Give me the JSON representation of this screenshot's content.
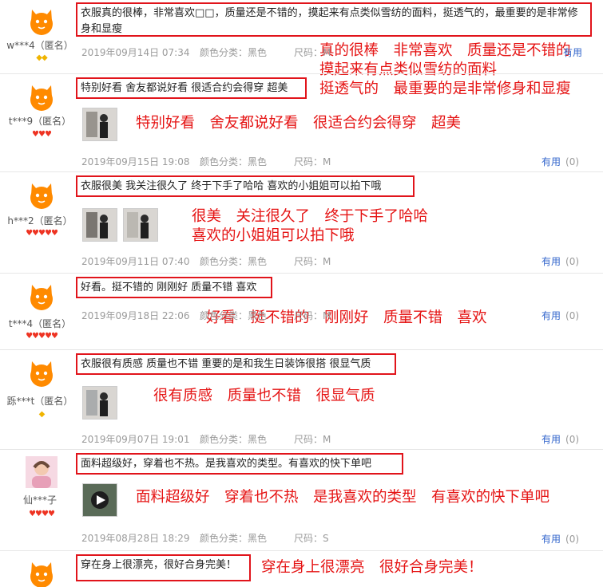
{
  "reviews": [
    {
      "user": "w***4（匿名）",
      "badges": [
        "gold",
        "gold"
      ],
      "comment": "衣服真的很棒，非常喜欢□□，质量还是不错的，摸起来有点类似雪纺的面料，挺透气的，最重要的是非常修身和显瘦",
      "annotation_lines": [
        "真的很棒　非常喜欢　质量还是不错的",
        "摸起来有点类似雪纺的面料",
        "挺透气的　最重要的是非常修身和显瘦"
      ],
      "date": "2019年09月14日 07:34",
      "color": "颜色分类：黑色",
      "size": "尺码：M",
      "useful_label": "有用",
      "useful_count": "(0)",
      "thumbs": []
    },
    {
      "user": "t***9（匿名）",
      "badges": [
        "red",
        "red",
        "red"
      ],
      "comment": "特别好看 舍友都说好看 很适合约会得穿 超美",
      "annotation_lines": [
        "特别好看　舍友都说好看　很适合约会得穿　超美"
      ],
      "date": "2019年09月15日 19:08",
      "color": "颜色分类：黑色",
      "size": "尺码：M",
      "useful_label": "有用",
      "useful_count": "(0)",
      "thumbs": [
        "photo-1"
      ]
    },
    {
      "user": "h***2（匿名）",
      "badges": [
        "red",
        "red",
        "red",
        "red",
        "red"
      ],
      "comment": "衣服很美 我关注很久了 终于下手了哈哈 喜欢的小姐姐可以拍下哦",
      "annotation_lines": [
        "很美　关注很久了　终于下手了哈哈",
        "喜欢的小姐姐可以拍下哦"
      ],
      "date": "2019年09月11日 07:40",
      "color": "颜色分类：黑色",
      "size": "尺码：M",
      "useful_label": "有用",
      "useful_count": "(0)",
      "thumbs": [
        "photo-1",
        "photo-2"
      ]
    },
    {
      "user": "t***4（匿名）",
      "badges": [
        "red",
        "red",
        "red",
        "red",
        "red"
      ],
      "comment": "好看。挺不错的 刚刚好 质量不错 喜欢",
      "annotation_lines": [
        "好看　挺不错的　刚刚好　质量不错　喜欢"
      ],
      "date": "2019年09月18日 22:06",
      "color": "颜色分类：黑色",
      "size": "尺码：M",
      "useful_label": "有用",
      "useful_count": "(0)",
      "thumbs": []
    },
    {
      "user": "跞***t（匿名）",
      "badges": [
        "gold"
      ],
      "comment": "衣服很有质感 质量也不错 重要的是和我生日装饰很搭 很显气质",
      "annotation_lines": [
        "很有质感　质量也不错　很显气质"
      ],
      "date": "2019年09月07日 19:01",
      "color": "颜色分类：黑色",
      "size": "尺码：M",
      "useful_label": "有用",
      "useful_count": "(0)",
      "thumbs": [
        "photo-1"
      ]
    },
    {
      "user": "仙***子",
      "badges": [
        "red",
        "red",
        "red",
        "red"
      ],
      "comment": "面料超级好，穿着也不热。是我喜欢的类型。有喜欢的快下单吧",
      "annotation_lines": [
        "面料超级好　穿着也不热　是我喜欢的类型　有喜欢的快下单吧"
      ],
      "date": "2019年08月28日 18:29",
      "color": "颜色分类：黑色",
      "size": "尺码：S",
      "useful_label": "有用",
      "useful_count": "(0)",
      "thumbs": [
        "video-1"
      ]
    },
    {
      "user": "",
      "badges": [],
      "comment": "穿在身上很漂亮，很好合身完美！",
      "annotation_lines": [
        "穿在身上很漂亮　很好合身完美！"
      ],
      "date": "",
      "color": "",
      "size": "",
      "useful_label": "",
      "useful_count": "",
      "thumbs": []
    }
  ],
  "top_right_fragment": "有用",
  "colors": {
    "annotation": "#e51414",
    "highlight_border": "#e1141b",
    "link": "#3366cc",
    "avatar": "#ff8a00"
  }
}
